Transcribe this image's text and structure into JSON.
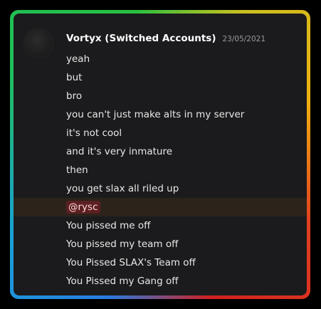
{
  "author": {
    "name": "Vortyx (Switched Accounts)",
    "timestamp": "23/05/2021"
  },
  "messages": [
    {
      "text": "yeah"
    },
    {
      "text": "but"
    },
    {
      "text": "bro"
    },
    {
      "text": "you can't just make alts in my server"
    },
    {
      "text": "it's not cool"
    },
    {
      "text": "and it's very inmature"
    },
    {
      "text": "then"
    },
    {
      "text": "you get slax all riled up"
    },
    {
      "mention": "@rysc"
    },
    {
      "text": "You pissed me off"
    },
    {
      "text": "You pissed my team off"
    },
    {
      "text": "You Pissed SLAX's Team off"
    },
    {
      "text": "You Pissed my Gang off"
    }
  ],
  "colors": {
    "panel_background": "#1b1b1d",
    "mention_highlight_row": "#2c231b",
    "mention_pill": "#5c1f22"
  }
}
